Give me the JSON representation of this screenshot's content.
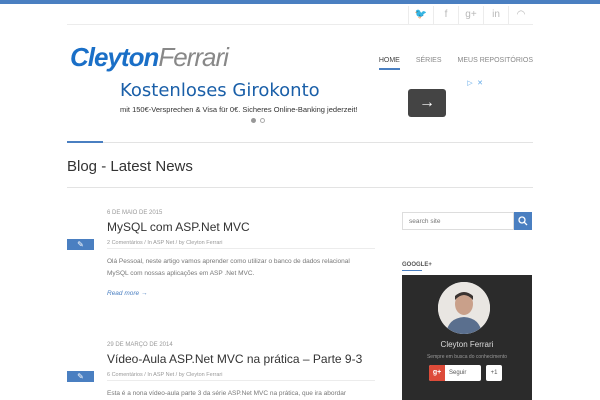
{
  "site": {
    "logo_part1": "Cleyton",
    "logo_part2": "Ferrari"
  },
  "social_icons": [
    "twitter-icon",
    "facebook-icon",
    "google-plus-icon",
    "linkedin-icon",
    "rss-icon"
  ],
  "nav": {
    "home": "HOME",
    "series": "SÉRIES",
    "repos": "MEUS REPOSITÓRIOS"
  },
  "ad": {
    "title": "Kostenloses Girokonto",
    "subtitle": "mit 150€-Versprechen & Visa für 0€. Sicheres Online-Banking jederzeit!",
    "button_icon": "arrow-right-icon"
  },
  "page": {
    "title": "Blog - Latest News"
  },
  "posts": [
    {
      "date": "6 DE MAIO DE 2015",
      "title": "MySQL com ASP.Net MVC",
      "meta": "2 Comentários  /  In ASP Net  /  by Cleyton Ferrari",
      "excerpt": "Olá Pessoal, neste artigo vamos aprender como utilizar o banco de dados relacional MySQL com nossas aplicações em ASP .Net MVC.",
      "more": "Read more →"
    },
    {
      "date": "29 DE MARÇO DE 2014",
      "title": "Vídeo-Aula ASP.Net MVC na prática – Parte 9-3",
      "meta": "6 Comentários  /  In ASP Net  /  by Cleyton Ferrari",
      "excerpt": "Esta é a nona vídeo-aula parte 3 da série ASP.Net MVC na prática, que ira abordar"
    }
  ],
  "sidebar": {
    "search_placeholder": "search site",
    "gplus_heading": "GOOGLE+",
    "gplus_name": "Cleyton Ferrari",
    "gplus_tagline": "Sempre em busca do conhecimento",
    "follow_label": "Seguir",
    "plus_one": "+1"
  },
  "colors": {
    "accent": "#4a7fc1",
    "logo_blue": "#1a6fc7",
    "gplus_red": "#dd4b39"
  }
}
